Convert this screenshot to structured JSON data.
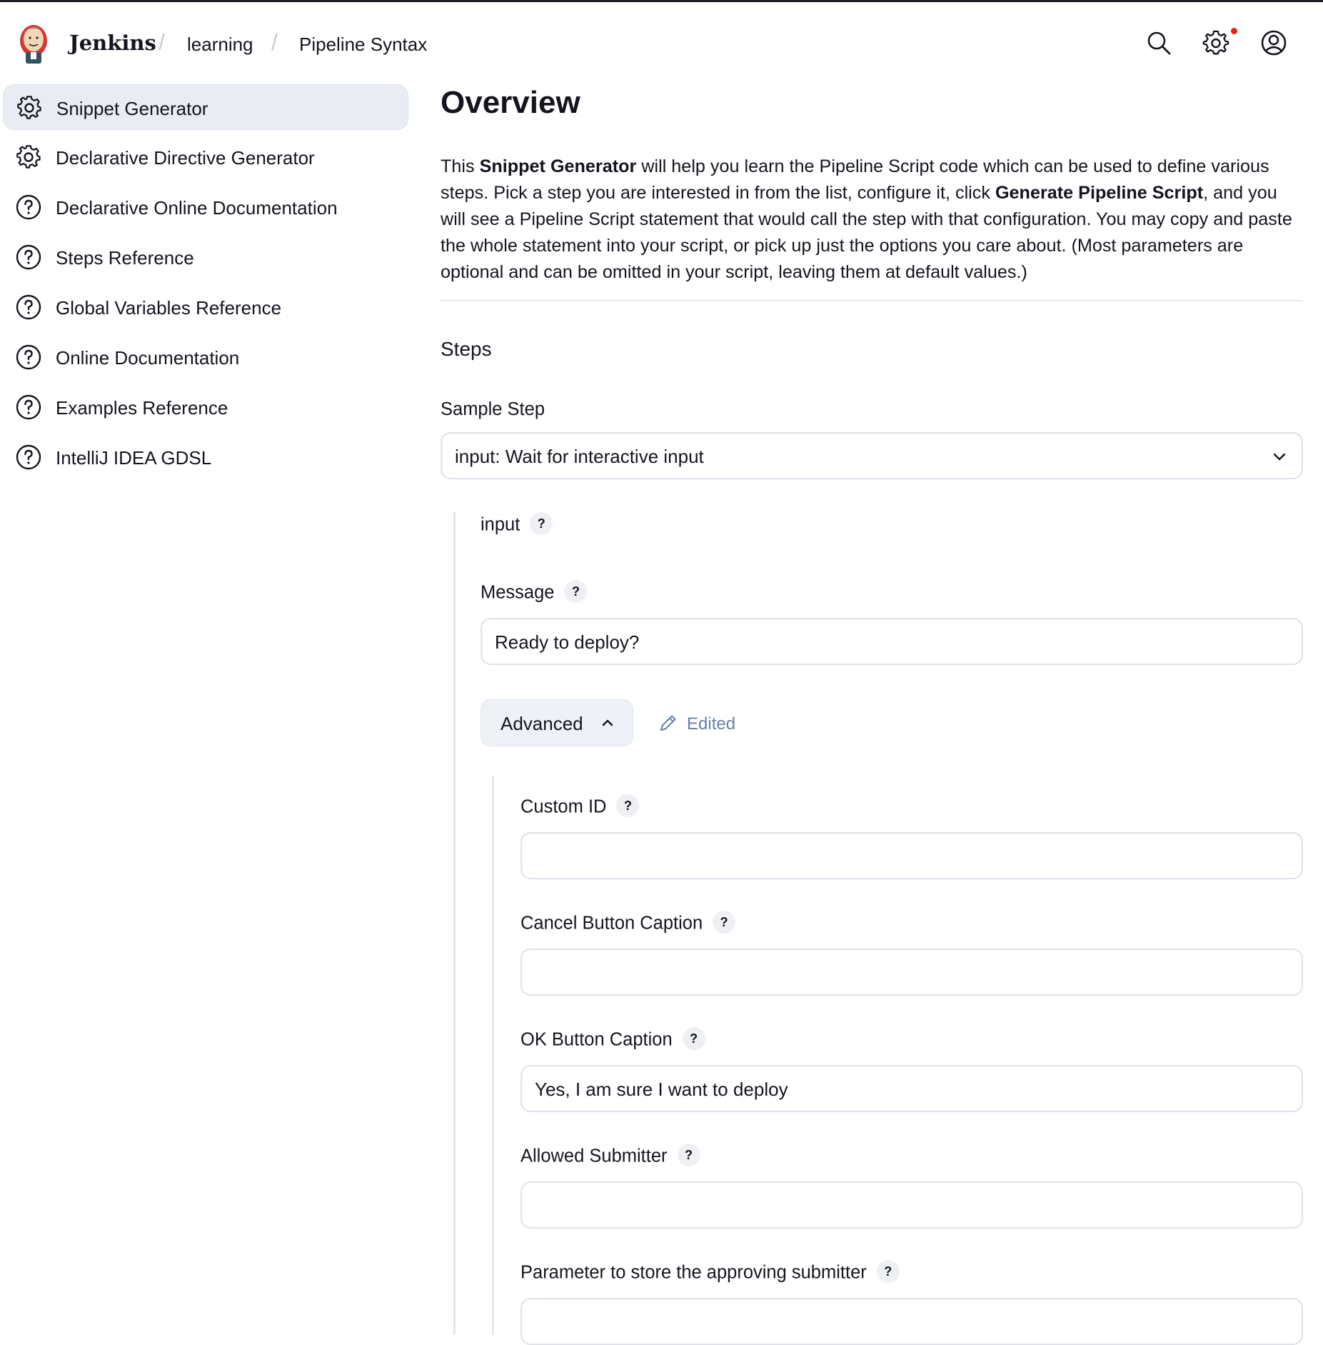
{
  "header": {
    "brand": "Jenkins",
    "breadcrumbs": [
      "learning",
      "Pipeline Syntax"
    ],
    "icons": [
      "search-icon",
      "gear-icon",
      "user-icon"
    ],
    "notification_color": "#e5231c"
  },
  "sidebar": {
    "items": [
      {
        "label": "Snippet Generator",
        "icon": "gear-icon",
        "active": true
      },
      {
        "label": "Declarative Directive Generator",
        "icon": "gear-icon"
      },
      {
        "label": "Declarative Online Documentation",
        "icon": "help-circle-icon"
      },
      {
        "label": "Steps Reference",
        "icon": "help-circle-icon"
      },
      {
        "label": "Global Variables Reference",
        "icon": "help-circle-icon"
      },
      {
        "label": "Online Documentation",
        "icon": "help-circle-icon"
      },
      {
        "label": "Examples Reference",
        "icon": "help-circle-icon"
      },
      {
        "label": "IntelliJ IDEA GDSL",
        "icon": "help-circle-icon"
      }
    ]
  },
  "main": {
    "title": "Overview",
    "description": {
      "part1": "This ",
      "bold1": "Snippet Generator",
      "part2": " will help you learn the Pipeline Script code which can be used to define various steps. Pick a step you are interested in from the list, configure it, click ",
      "bold2": "Generate Pipeline Script",
      "part3": ", and you will see a Pipeline Script statement that would call the step with that configuration. You may copy and paste the whole statement into your script, or pick up just the options you care about. (Most parameters are optional and can be omitted in your script, leaving them at default values.)"
    },
    "steps_title": "Steps",
    "sample_step_label": "Sample Step",
    "sample_step_value": "input: Wait for interactive input",
    "step_name": "input",
    "help_glyph": "?",
    "message_label": "Message",
    "message_value": "Ready to deploy?",
    "advanced_label": "Advanced",
    "edited_label": "Edited",
    "custom_id_label": "Custom ID",
    "custom_id_value": "",
    "cancel_caption_label": "Cancel Button Caption",
    "cancel_caption_value": "",
    "ok_caption_label": "OK Button Caption",
    "ok_caption_value": "Yes, I am sure I want to deploy",
    "allowed_submitter_label": "Allowed Submitter",
    "allowed_submitter_value": "",
    "submitter_param_label": "Parameter to store the approving submitter",
    "submitter_param_value": ""
  }
}
